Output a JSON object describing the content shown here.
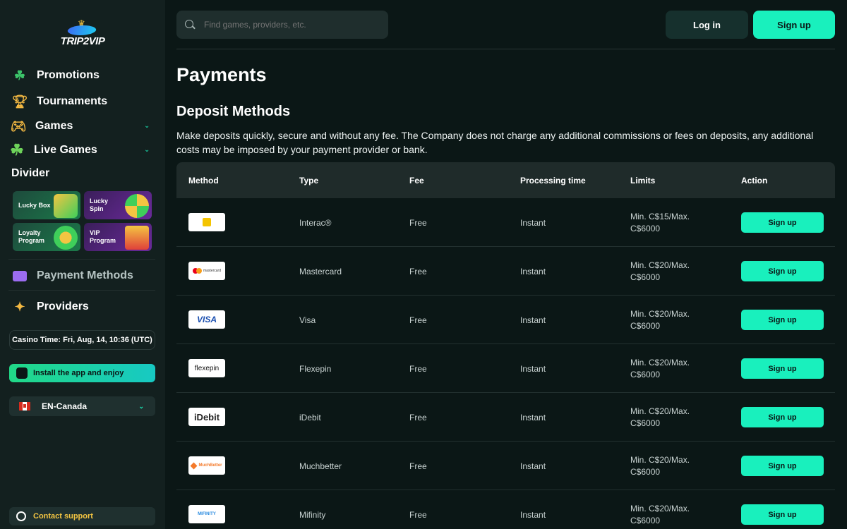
{
  "brand": {
    "logo_text": "TRIP2VIP"
  },
  "sidebar": {
    "nav": [
      {
        "label": "Promotions",
        "icon": "clover-icon"
      },
      {
        "label": "Tournaments",
        "icon": "trophy-icon"
      },
      {
        "label": "Games",
        "icon": "gamepad-icon"
      },
      {
        "label": "Live Games",
        "icon": "live-clover-icon"
      }
    ],
    "divider_label": "Divider",
    "cards": [
      {
        "label": "Lucky Box"
      },
      {
        "label": "Lucky Spin"
      },
      {
        "label": "Loyalty Program"
      },
      {
        "label": "VIP Program"
      }
    ],
    "payment_methods": "Payment Methods",
    "providers": "Providers",
    "casino_time": "Casino Time: Fri, Aug, 14, 10:36 (UTC)",
    "install": "Install the app and enjoy",
    "language": "EN-Canada",
    "support": "Contact support"
  },
  "header": {
    "search_placeholder": "Find games, providers, etc.",
    "login": "Log in",
    "signup": "Sign up"
  },
  "main": {
    "title": "Payments",
    "section_title": "Deposit Methods",
    "description": "Make deposits quickly, secure and without any fee. The Company does not charge any additional commissions or fees on deposits, any additional costs may be imposed by your payment provider or bank.",
    "columns": [
      "Method",
      "Type",
      "Fee",
      "Processing time",
      "Limits",
      "Action"
    ],
    "rows": [
      {
        "logo": "interac",
        "type": "Interac®",
        "fee": "Free",
        "time": "Instant",
        "limits": "Min. C$15/Max. C$6000",
        "action": "Sign up"
      },
      {
        "logo": "mastercard",
        "type": "Mastercard",
        "fee": "Free",
        "time": "Instant",
        "limits": "Min. C$20/Max. C$6000",
        "action": "Sign up"
      },
      {
        "logo": "VISA",
        "type": "Visa",
        "fee": "Free",
        "time": "Instant",
        "limits": "Min. C$20/Max. C$6000",
        "action": "Sign up"
      },
      {
        "logo": "flexepin",
        "type": "Flexepin",
        "fee": "Free",
        "time": "Instant",
        "limits": "Min. C$20/Max. C$6000",
        "action": "Sign up"
      },
      {
        "logo": "iDebit",
        "type": "iDebit",
        "fee": "Free",
        "time": "Instant",
        "limits": "Min. C$20/Max. C$6000",
        "action": "Sign up"
      },
      {
        "logo": "MuchBetter",
        "type": "Muchbetter",
        "fee": "Free",
        "time": "Instant",
        "limits": "Min. C$20/Max. C$6000",
        "action": "Sign up"
      },
      {
        "logo": "MIFINITY",
        "type": "Mifinity",
        "fee": "Free",
        "time": "Instant",
        "limits": "Min. C$20/Max. C$6000",
        "action": "Sign up"
      }
    ]
  },
  "colors": {
    "accent": "#19f0bd",
    "background": "#0b1716",
    "sidebar": "#13201f"
  }
}
